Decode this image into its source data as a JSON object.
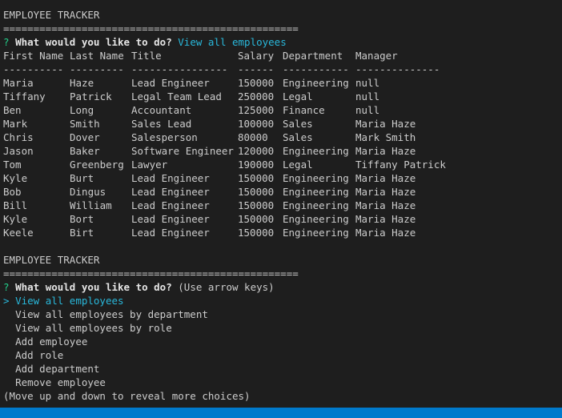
{
  "title1": "EMPLOYEE TRACKER",
  "separator": "=================================================",
  "prompt1": {
    "mark": "?",
    "question": "What would you like to do?",
    "answer": "View all employees"
  },
  "table": {
    "headers": [
      "First Name",
      "Last Name",
      "Title",
      "Salary",
      "Department",
      "Manager"
    ],
    "dashes": [
      "----------",
      "---------",
      "----------------",
      "------",
      "-----------",
      "--------------"
    ],
    "rows": [
      [
        "Maria",
        "Haze",
        "Lead Engineer",
        "150000",
        "Engineering",
        "null"
      ],
      [
        "Tiffany",
        "Patrick",
        "Legal Team Lead",
        "250000",
        "Legal",
        "null"
      ],
      [
        "Ben",
        "Long",
        "Accountant",
        "125000",
        "Finance",
        "null"
      ],
      [
        "Mark",
        "Smith",
        "Sales Lead",
        "100000",
        "Sales",
        "Maria Haze"
      ],
      [
        "Chris",
        "Dover",
        "Salesperson",
        "80000",
        "Sales",
        "Mark Smith"
      ],
      [
        "Jason",
        "Baker",
        "Software Engineer",
        "120000",
        "Engineering",
        "Maria Haze"
      ],
      [
        "Tom",
        "Greenberg",
        "Lawyer",
        "190000",
        "Legal",
        "Tiffany Patrick"
      ],
      [
        "Kyle",
        "Burt",
        "Lead Engineer",
        "150000",
        "Engineering",
        "Maria Haze"
      ],
      [
        "Bob",
        "Dingus",
        "Lead Engineer",
        "150000",
        "Engineering",
        "Maria Haze"
      ],
      [
        "Bill",
        "William",
        "Lead Engineer",
        "150000",
        "Engineering",
        "Maria Haze"
      ],
      [
        "Kyle",
        "Bort",
        "Lead Engineer",
        "150000",
        "Engineering",
        "Maria Haze"
      ],
      [
        "Keele",
        "Birt",
        "Lead Engineer",
        "150000",
        "Engineering",
        "Maria Haze"
      ]
    ]
  },
  "title2": "EMPLOYEE TRACKER",
  "prompt2": {
    "mark": "?",
    "question": "What would you like to do?",
    "hint": "(Use arrow keys)"
  },
  "menu": {
    "pointer": ">",
    "selected": "View all employees",
    "items": [
      "View all employees by department",
      "View all employees by role",
      "Add employee",
      "Add role",
      "Add department",
      "Remove employee"
    ],
    "footer": "(Move up and down to reveal more choices)"
  },
  "colors": {
    "background": "#1e1e1e",
    "text": "#cccccc",
    "prompt_mark": "#23d18b",
    "answer": "#29b8db",
    "status_bar": "#007acc"
  }
}
